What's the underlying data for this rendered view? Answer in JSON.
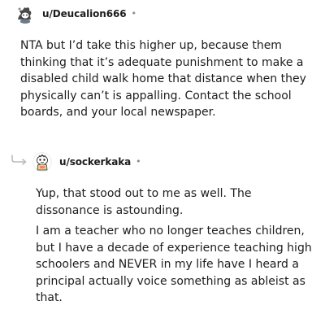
{
  "comments": [
    {
      "username": "u/Deucalion666",
      "dot": "•",
      "paragraphs": [
        "NTA but I’d take this higher up, because them thinking that it’s adequate punishment to make a disabled child walk home that distance when they physically can’t is appalling. Contact the school boards, and your local newspaper."
      ]
    },
    {
      "username": "u/sockerkaka",
      "dot": "•",
      "paragraphs": [
        "Yup, that stood out to me as well. The dissonance is astounding.",
        "I am a teacher who no longer teaches children, but I have a decade of experience teaching high schoolers and NEVER in my life have I heard a principal actually voice something as ableist as that."
      ]
    }
  ],
  "colors": {
    "text": "#1c1c1c",
    "meta": "#878a8c",
    "thread_line": "#d0d3d5"
  },
  "icons": {
    "reply": "reply-arrow-icon",
    "avatar": "snoo-avatar-icon"
  }
}
